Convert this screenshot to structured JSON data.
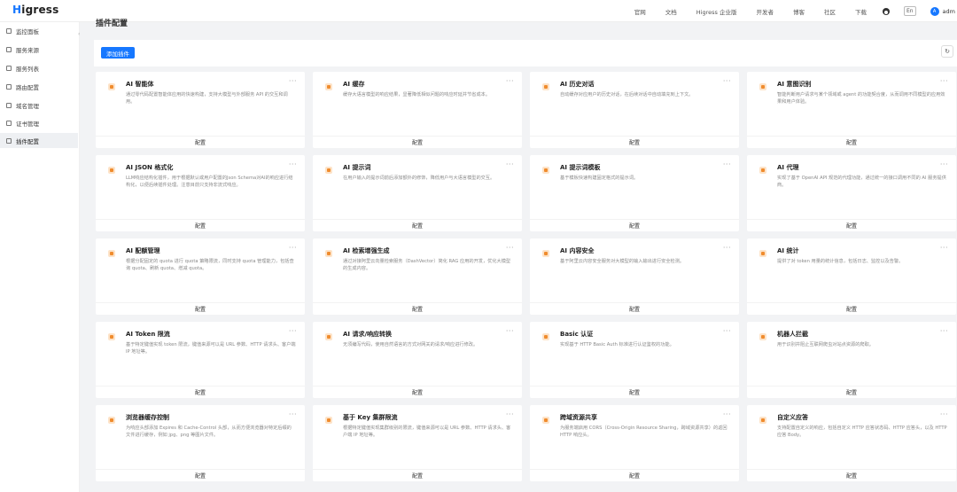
{
  "header": {
    "logo_prefix": "H",
    "logo_rest": "igress",
    "nav": [
      "官网",
      "文档",
      "Higress 企业版",
      "开发者",
      "博客",
      "社区",
      "下载"
    ],
    "lang": "En",
    "avatar": "A",
    "user": "adm"
  },
  "sidebar": {
    "items": [
      {
        "label": "监控面板",
        "icon": "dashboard-icon"
      },
      {
        "label": "服务来源",
        "icon": "source-icon"
      },
      {
        "label": "服务列表",
        "icon": "list-icon"
      },
      {
        "label": "路由配置",
        "icon": "route-icon"
      },
      {
        "label": "域名管理",
        "icon": "domain-icon"
      },
      {
        "label": "证书管理",
        "icon": "certificate-icon"
      },
      {
        "label": "插件配置",
        "icon": "plugin-icon"
      }
    ],
    "active_index": 6
  },
  "main": {
    "title": "插件配置",
    "add_button": "添加插件",
    "refresh_icon": "refresh-icon"
  },
  "cards": [
    {
      "title": "AI 智能体",
      "desc": "通过零代码配置智能体应用的快速构建，支持大模型与外部服务 API 的交互和调用。",
      "action": "配置"
    },
    {
      "title": "AI 缓存",
      "desc": "缓存大语言模型的响应结果，显著降低相似问题的响应时延并节省成本。",
      "action": "配置"
    },
    {
      "title": "AI 历史对话",
      "desc": "自动缓存对应用户的历史对话，在后续对话中自动填充到上下文。",
      "action": "配置"
    },
    {
      "title": "AI 意图识别",
      "desc": "智能判断用户请求与某个领域或 agent 的功能契合度，从而调用不同模型的应用效果和用户体验。",
      "action": "配置"
    },
    {
      "title": "AI JSON 格式化",
      "desc": "LLM响应结构化插件，用于根据默认或用户配置的Json Schema对AI的响应进行结构化，以便后续插件处理。注意目前只支持非流式响应。",
      "action": "配置"
    },
    {
      "title": "AI 提示词",
      "desc": "在用户输入的提示词前后添加额外的修饰，降低用户与大语言模型的交互。",
      "action": "配置"
    },
    {
      "title": "AI 提示词模板",
      "desc": "基于模板快速构建固定格式的提示词。",
      "action": "配置"
    },
    {
      "title": "AI 代理",
      "desc": "实现了基于 OpenAI API 规范的代理功能，通过统一的接口调用不同的 AI 服务提供商。",
      "action": "配置"
    },
    {
      "title": "AI 配额管理",
      "desc": "根据分配固定的 quota 进行 quota 策略限流，同时支持 quota 管理能力，包括查询 quota、刷新 quota、增减 quota。",
      "action": "配置"
    },
    {
      "title": "AI 检索增强生成",
      "desc": "通过对接阿里云向量检索服务（DashVector）简化 RAG 应用的开发，优化大模型的生成内容。",
      "action": "配置"
    },
    {
      "title": "AI 内容安全",
      "desc": "基于阿里云内容安全服务对大模型的输入输出进行安全检测。",
      "action": "配置"
    },
    {
      "title": "AI 统计",
      "desc": "提供了对 token 用量的统计信息，包括日志、监控以及告警。",
      "action": "配置"
    },
    {
      "title": "AI Token 限流",
      "desc": "基于特定键值实现 token 限流，键值来源可以是 URL 参数、HTTP 请求头、客户端 IP 地址等。",
      "action": "配置"
    },
    {
      "title": "AI 请求/响应转换",
      "desc": "无须编写代码，使用自然语言的方式对网关的请求/响应进行修改。",
      "action": "配置"
    },
    {
      "title": "Basic 认证",
      "desc": "实现基于 HTTP Basic Auth 标准进行认证鉴权的功能。",
      "action": "配置"
    },
    {
      "title": "机器人拦截",
      "desc": "用于识别并阻止互联网爬虫对站点资源的爬取。",
      "action": "配置"
    },
    {
      "title": "浏览器缓存控制",
      "desc": "为响应头部添加 Expires 和 Cache-Control 头部，从而方便浏览器对特定后缀的文件进行缓存，例如 jpg、png 等图片文件。",
      "action": "配置"
    },
    {
      "title": "基于 Key 集群限流",
      "desc": "根据特定键值实现集群级别的限流，键值来源可以是 URL 参数、HTTP 请求头、客户端 IP 地址等。",
      "action": "配置"
    },
    {
      "title": "跨域资源共享",
      "desc": "为服务端启用 CORS（Cross-Origin Resource Sharing，跨域资源共享）的返回 HTTP 响应头。",
      "action": "配置"
    },
    {
      "title": "自定义应答",
      "desc": "支持配置自定义的响应，包括自定义 HTTP 应答状态码、HTTP 应答头，以及 HTTP 应答 Body。",
      "action": "配置"
    }
  ]
}
